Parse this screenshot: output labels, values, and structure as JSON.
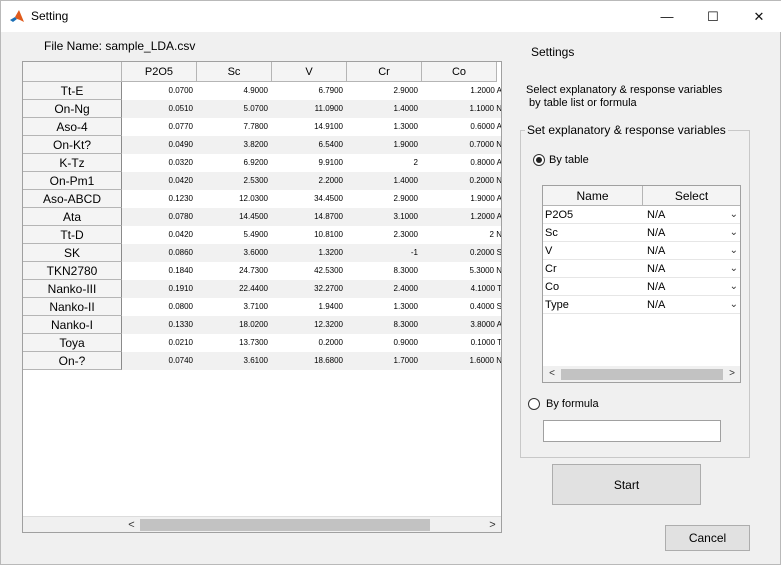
{
  "window": {
    "title": "Setting",
    "minimize_glyph": "—",
    "maximize_glyph": "☐",
    "close_glyph": "✕"
  },
  "file_label": "File Name: sample_LDA.csv",
  "table": {
    "columns": [
      "P2O5",
      "Sc",
      "V",
      "Cr",
      "Co"
    ],
    "rows": [
      {
        "name": "Tt-E",
        "values": [
          "0.0700",
          "4.9000",
          "6.7900",
          "2.9000",
          "1.2000 A"
        ]
      },
      {
        "name": "On-Ng",
        "values": [
          "0.0510",
          "5.0700",
          "11.0900",
          "1.4000",
          "1.1000 N"
        ]
      },
      {
        "name": "Aso-4",
        "values": [
          "0.0770",
          "7.7800",
          "14.9100",
          "1.3000",
          "0.6000 A"
        ]
      },
      {
        "name": "On-Kt?",
        "values": [
          "0.0490",
          "3.8200",
          "6.5400",
          "1.9000",
          "0.7000 N"
        ]
      },
      {
        "name": "K-Tz",
        "values": [
          "0.0320",
          "6.9200",
          "9.9100",
          "2",
          "0.8000 A"
        ]
      },
      {
        "name": "On-Pm1",
        "values": [
          "0.0420",
          "2.5300",
          "2.2000",
          "1.4000",
          "0.2000 N"
        ]
      },
      {
        "name": "Aso-ABCD",
        "values": [
          "0.1230",
          "12.0300",
          "34.4500",
          "2.9000",
          "1.9000 A"
        ]
      },
      {
        "name": "Ata",
        "values": [
          "0.0780",
          "14.4500",
          "14.8700",
          "3.1000",
          "1.2000 A"
        ]
      },
      {
        "name": "Tt-D",
        "values": [
          "0.0420",
          "5.4900",
          "10.8100",
          "2.3000",
          "2 N"
        ]
      },
      {
        "name": "SK",
        "values": [
          "0.0860",
          "3.6000",
          "1.3200",
          "-1",
          "0.2000 S"
        ]
      },
      {
        "name": "TKN2780",
        "values": [
          "0.1840",
          "24.7300",
          "42.5300",
          "8.3000",
          "5.3000 N"
        ]
      },
      {
        "name": "Nanko-III",
        "values": [
          "0.1910",
          "22.4400",
          "32.2700",
          "2.4000",
          "4.1000 T"
        ]
      },
      {
        "name": "Nanko-II",
        "values": [
          "0.0800",
          "3.7100",
          "1.9400",
          "1.3000",
          "0.4000 S"
        ]
      },
      {
        "name": "Nanko-I",
        "values": [
          "0.1330",
          "18.0200",
          "12.3200",
          "8.3000",
          "3.8000 A"
        ]
      },
      {
        "name": "Toya",
        "values": [
          "0.0210",
          "13.7300",
          "0.2000",
          "0.9000",
          "0.1000 T"
        ]
      },
      {
        "name": "On-?",
        "values": [
          "0.0740",
          "3.6100",
          "18.6800",
          "1.7000",
          "1.6000 N"
        ]
      }
    ],
    "scroll_left_glyph": "<",
    "scroll_right_glyph": ">"
  },
  "settings": {
    "title": "Settings",
    "instruction": "Select explanatory & response variables\n by table list or formula",
    "group_label": "Set explanatory & response variables",
    "by_table_label": "By table",
    "by_formula_label": "By formula",
    "by_table_selected": true,
    "var_table": {
      "headers": [
        "Name",
        "Select"
      ],
      "rows": [
        {
          "name": "P2O5",
          "select": "N/A"
        },
        {
          "name": "Sc",
          "select": "N/A"
        },
        {
          "name": "V",
          "select": "N/A"
        },
        {
          "name": "Cr",
          "select": "N/A"
        },
        {
          "name": "Co",
          "select": "N/A"
        },
        {
          "name": "Type",
          "select": "N/A"
        }
      ],
      "chevron_glyph": "⌄",
      "scroll_left_glyph": "<",
      "scroll_right_glyph": ">"
    },
    "formula_value": "",
    "start_label": "Start",
    "cancel_label": "Cancel"
  }
}
